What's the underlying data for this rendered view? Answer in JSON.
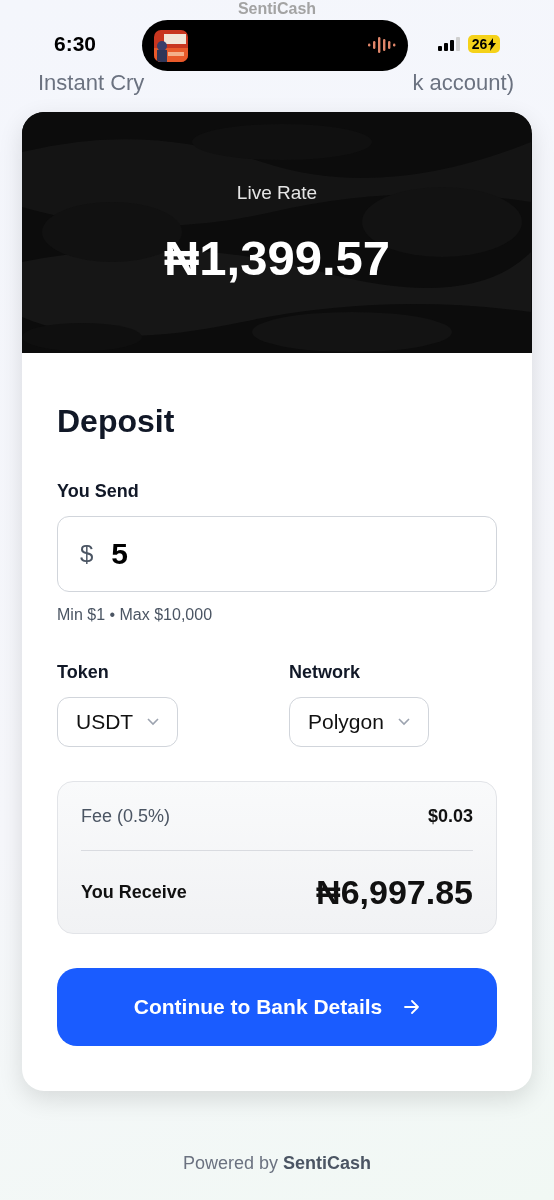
{
  "status_bar": {
    "time": "6:30",
    "battery": "26"
  },
  "header": {
    "title": "SentiCash",
    "subtitle_parts": [
      "Instant Cry",
      "k account)"
    ]
  },
  "rate": {
    "label": "Live Rate",
    "value": "₦1,399.57"
  },
  "deposit": {
    "title": "Deposit",
    "send_label": "You Send",
    "currency": "$",
    "amount": "5",
    "limits": "Min $1 • Max $10,000",
    "selects": [
      {
        "label": "Token",
        "value": "USDT"
      },
      {
        "label": "Network",
        "value": "Polygon"
      }
    ],
    "summary": [
      {
        "kind": "fee",
        "label": "Fee (0.5%)",
        "value": "$0.03"
      },
      {
        "kind": "total",
        "label": "You Receive",
        "value": "₦6,997.85"
      }
    ],
    "button": "Continue to Bank Details"
  },
  "footer": {
    "text": "Powered by **SentiCash**"
  }
}
